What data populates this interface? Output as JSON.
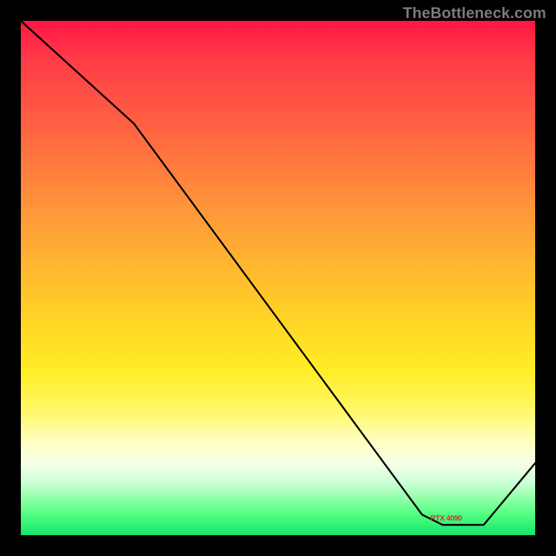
{
  "watermark": "TheBottleneck.com",
  "annotation_label": "RTX 4090",
  "chart_data": {
    "type": "line",
    "title": "",
    "xlabel": "",
    "ylabel": "",
    "xlim": [
      0,
      100
    ],
    "ylim": [
      0,
      100
    ],
    "series": [
      {
        "name": "curve",
        "x": [
          0,
          22,
          78,
          82,
          90,
          100
        ],
        "y": [
          100,
          80,
          4,
          2,
          2,
          14
        ]
      }
    ],
    "annotation": {
      "x": 85,
      "y": 3,
      "text": "RTX 4090"
    }
  }
}
